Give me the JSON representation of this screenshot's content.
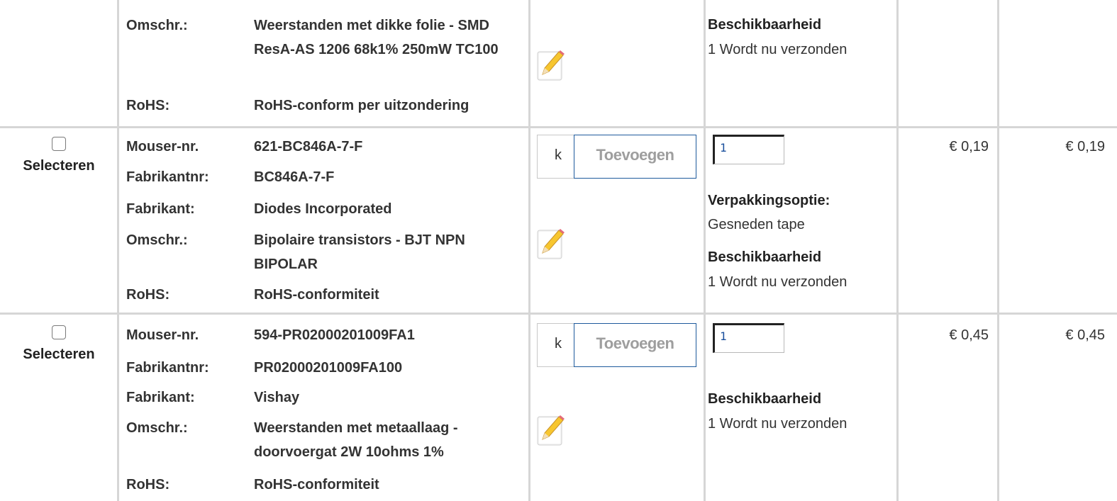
{
  "rows": [
    {
      "attributes": [
        {
          "label": "Omschr.:",
          "value": "Weerstanden met dikke folie - SMD ResA-AS 1206 68k1% 250mW TC100"
        },
        {
          "label": "RoHS:",
          "value": "RoHS-conform per uitzondering"
        }
      ],
      "availability_heading": "Beschikbaarheid",
      "availability_text": "1 Wordt nu verzonden"
    },
    {
      "select_label": "Selecteren",
      "attributes": [
        {
          "label": "Mouser-nr.",
          "value": "621-BC846A-7-F"
        },
        {
          "label": "Fabrikantnr:",
          "value": "BC846A-7-F"
        },
        {
          "label": "Fabrikant:",
          "value": "Diodes Incorporated"
        },
        {
          "label": "Omschr.:",
          "value": "Bipolaire transistors - BJT NPN BIPOLAR"
        },
        {
          "label": "RoHS:",
          "value": "RoHS-conformiteit"
        }
      ],
      "add_hint": "k",
      "add_button": "Toevoegen",
      "quantity": "1",
      "packaging_heading": "Verpakkingsoptie:",
      "packaging_value": "Gesneden tape",
      "availability_heading": "Beschikbaarheid",
      "availability_text": "1 Wordt nu verzonden",
      "unit_price": "€ 0,19",
      "ext_price": "€ 0,19"
    },
    {
      "select_label": "Selecteren",
      "attributes": [
        {
          "label": "Mouser-nr.",
          "value": "594-PR02000201009FA1"
        },
        {
          "label": "Fabrikantnr:",
          "value": "PR02000201009FA100"
        },
        {
          "label": "Fabrikant:",
          "value": "Vishay"
        },
        {
          "label": "Omschr.:",
          "value": "Weerstanden met metaallaag - doorvoergat 2W 10ohms 1%"
        },
        {
          "label": "RoHS:",
          "value": "RoHS-conformiteit"
        }
      ],
      "add_hint": "k",
      "add_button": "Toevoegen",
      "quantity": "1",
      "availability_heading": "Beschikbaarheid",
      "availability_text": "1 Wordt nu verzonden",
      "unit_price": "€ 0,45",
      "ext_price": "€ 0,45"
    }
  ],
  "icons": {
    "checkbox": "checkbox-icon",
    "edit": "pencil-edit-icon"
  }
}
